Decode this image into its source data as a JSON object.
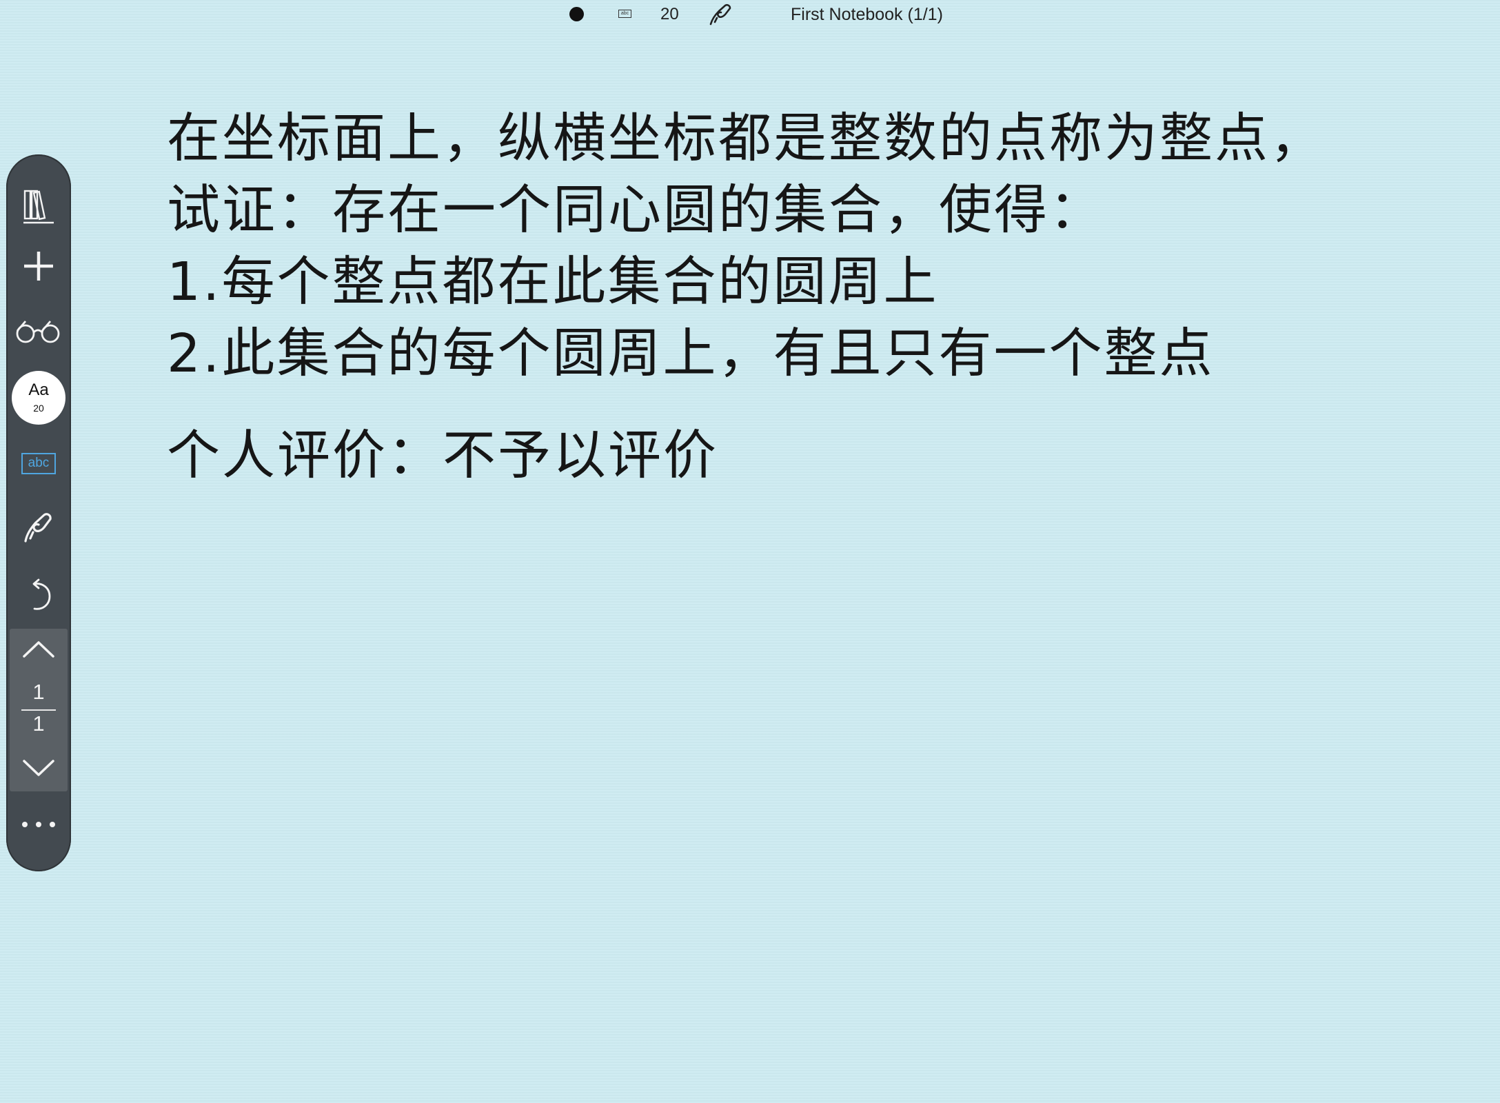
{
  "statusbar": {
    "pen_color_icon": "filled-circle-icon",
    "text_mode_icon_label": "abc",
    "font_size": "20",
    "pen_tool_icon": "pen-icon",
    "notebook_title": "First Notebook (1/1)"
  },
  "toolbar": {
    "items": [
      {
        "name": "library",
        "icon": "books-icon"
      },
      {
        "name": "add",
        "icon": "plus-icon"
      },
      {
        "name": "read-mode",
        "icon": "glasses-icon"
      },
      {
        "name": "font",
        "label": "Aa",
        "size": "20"
      },
      {
        "name": "text-recognition",
        "label": "abc"
      },
      {
        "name": "pen",
        "icon": "pen-icon"
      },
      {
        "name": "undo",
        "icon": "undo-icon"
      },
      {
        "name": "more",
        "icon": "more-dots-icon"
      }
    ],
    "font_button": {
      "label": "Aa",
      "size": "20"
    },
    "abc_label": "abc",
    "pager": {
      "current": "1",
      "total": "1"
    },
    "accent_color": "#4fa6e0",
    "background_color": "#434a50"
  },
  "note": {
    "lines": [
      "在坐标面上，纵横坐标都是整数的点称为整点，",
      "试证：存在一个同心圆的集合，使得：",
      "1.每个整点都在此集合的圆周上",
      "2.此集合的每个圆周上，有且只有一个整点",
      "个人评价：不予以评价"
    ]
  },
  "background_color": "#cdebf1"
}
